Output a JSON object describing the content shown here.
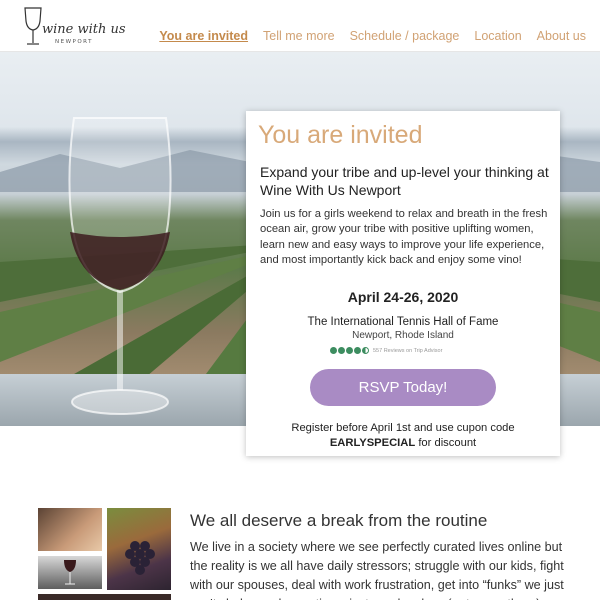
{
  "brand": {
    "logo_text": "wine with us",
    "logo_subtext": "NEWPORT"
  },
  "nav": {
    "items": [
      {
        "label": "You are invited",
        "active": true
      },
      {
        "label": "Tell me more",
        "active": false
      },
      {
        "label": "Schedule / package",
        "active": false
      },
      {
        "label": "Location",
        "active": false
      },
      {
        "label": "About us",
        "active": false
      }
    ]
  },
  "invite": {
    "title": "You are invited",
    "subtitle": "Expand your tribe and up-level your thinking at Wine With Us Newport",
    "body": "Join us for a girls weekend to relax and breath in the fresh ocean air, grow your tribe with positive uplifting women, learn new and easy ways to improve your life experience, and most importantly kick back and enjoy some vino!",
    "date": "April 24-26, 2020",
    "venue": "The International Tennis Hall of Fame",
    "city": "Newport, Rhode Island",
    "reviews": {
      "rating": 4.5,
      "max": 5,
      "text": "557 Reviews on Trip Advisor"
    },
    "rsvp_label": "RSVP Today!",
    "register_text": "Register before April 1st and use cupon code",
    "promo_code": "EARLYSPECIAL",
    "promo_suffix": "for discount"
  },
  "section": {
    "title": "We all deserve a break from the routine",
    "body": "We live in a society where we see perfectly curated lives online but the reality is we all have daily stressors; struggle with our kids, fight with our spouses, deal with work frustration, get into “funks” we just can't shake, and sometimes just need a glass (or two, or three)"
  },
  "colors": {
    "accent_gold": "#d8a979",
    "nav_gold": "#d1a274",
    "rsvp_purple": "#a98bc4",
    "tripadvisor_green": "#3d8d60"
  }
}
